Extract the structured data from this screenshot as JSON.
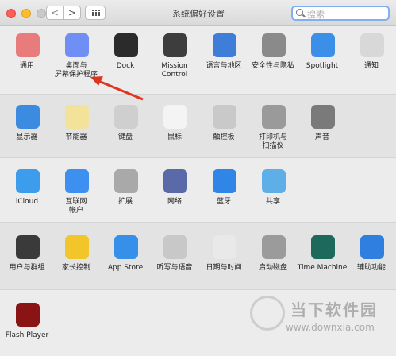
{
  "window": {
    "title": "系统偏好设置"
  },
  "toolbar": {
    "back": "<",
    "forward": ">"
  },
  "search": {
    "placeholder": "搜索"
  },
  "rows": [
    [
      {
        "name": "notifications-pane",
        "icon": "notification-icon",
        "label": "通用",
        "color": "#e87b7b"
      },
      {
        "name": "desktop-screensaver-pane",
        "icon": "desktop-screensaver-icon",
        "label": "桌面与\n屏幕保护程序",
        "color": "#6f8ff5"
      },
      {
        "name": "dock-pane",
        "icon": "dock-icon",
        "label": "Dock",
        "color": "#2b2b2b"
      },
      {
        "name": "mission-control-pane",
        "icon": "mission-control-icon",
        "label": "Mission\nControl",
        "color": "#3d3d3d"
      },
      {
        "name": "language-region-pane",
        "icon": "flag-icon",
        "label": "语言与地区",
        "color": "#3e7ed8"
      },
      {
        "name": "security-privacy-pane",
        "icon": "house-lock-icon",
        "label": "安全性与隐私",
        "color": "#8a8a8a"
      },
      {
        "name": "spotlight-pane",
        "icon": "spotlight-icon",
        "label": "Spotlight",
        "color": "#3c8fe8"
      },
      {
        "name": "notification-center-pane",
        "icon": "notification-center-icon",
        "label": "通知",
        "color": "#d8d8d8"
      }
    ],
    [
      {
        "name": "displays-pane",
        "icon": "display-icon",
        "label": "显示器",
        "color": "#3b8be0"
      },
      {
        "name": "energy-saver-pane",
        "icon": "lightbulb-icon",
        "label": "节能器",
        "color": "#f2e29a"
      },
      {
        "name": "keyboard-pane",
        "icon": "keyboard-icon",
        "label": "键盘",
        "color": "#cfcfcf"
      },
      {
        "name": "mouse-pane",
        "icon": "mouse-icon",
        "label": "鼠标",
        "color": "#f4f4f4"
      },
      {
        "name": "trackpad-pane",
        "icon": "trackpad-icon",
        "label": "触控板",
        "color": "#c9c9c9"
      },
      {
        "name": "printers-pane",
        "icon": "printer-icon",
        "label": "打印机与\n扫描仪",
        "color": "#9a9a9a"
      },
      {
        "name": "sound-pane",
        "icon": "speaker-icon",
        "label": "声音",
        "color": "#7a7a7a"
      }
    ],
    [
      {
        "name": "icloud-pane",
        "icon": "icloud-icon",
        "label": "iCloud",
        "color": "#3d9ded"
      },
      {
        "name": "internet-accounts-pane",
        "icon": "at-sign-icon",
        "label": "互联网\n帐户",
        "color": "#3d8ff0"
      },
      {
        "name": "extensions-pane",
        "icon": "puzzle-icon",
        "label": "扩展",
        "color": "#a9a9a9"
      },
      {
        "name": "network-pane",
        "icon": "globe-icon",
        "label": "网络",
        "color": "#5a6aa8"
      },
      {
        "name": "bluetooth-pane",
        "icon": "bluetooth-icon",
        "label": "蓝牙",
        "color": "#2f86e6"
      },
      {
        "name": "sharing-pane",
        "icon": "sharing-folder-icon",
        "label": "共享",
        "color": "#5eaee8"
      }
    ],
    [
      {
        "name": "users-groups-pane",
        "icon": "users-icon",
        "label": "用户与群组",
        "color": "#3a3a3a"
      },
      {
        "name": "parental-controls-pane",
        "icon": "parental-controls-icon",
        "label": "家长控制",
        "color": "#f2c52a"
      },
      {
        "name": "app-store-pane",
        "icon": "app-store-icon",
        "label": "App Store",
        "color": "#3690ea"
      },
      {
        "name": "dictation-speech-pane",
        "icon": "microphone-icon",
        "label": "听写与语音",
        "color": "#c8c8c8"
      },
      {
        "name": "date-time-pane",
        "icon": "clock-calendar-icon",
        "label": "日期与时间",
        "color": "#e9e9e9"
      },
      {
        "name": "startup-disk-pane",
        "icon": "disk-icon",
        "label": "启动磁盘",
        "color": "#9b9b9b"
      },
      {
        "name": "time-machine-pane",
        "icon": "time-machine-icon",
        "label": "Time Machine",
        "color": "#1d6a5c"
      },
      {
        "name": "accessibility-pane",
        "icon": "accessibility-icon",
        "label": "辅助功能",
        "color": "#2f7fe0"
      }
    ],
    [
      {
        "name": "flash-player-pane",
        "icon": "flash-icon",
        "label": "Flash Player",
        "color": "#8a1313"
      }
    ]
  ],
  "watermark": {
    "text": "当下软件园",
    "url": "www.downxia.com"
  },
  "annotation": {
    "arrow_color": "#e0341f",
    "arrow_target": "desktop-screensaver-pane"
  }
}
